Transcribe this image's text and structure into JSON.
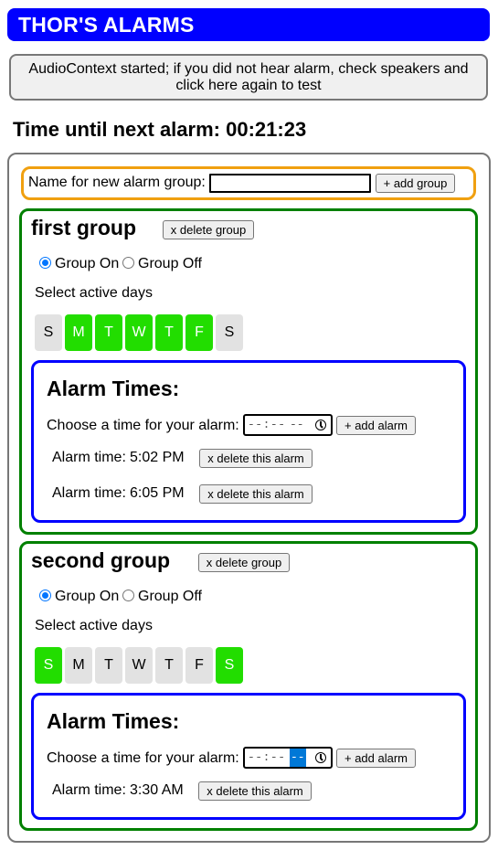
{
  "app": {
    "title": "THOR'S ALARMS"
  },
  "audio_button": {
    "text": "AudioContext started; if you did not hear alarm, check speakers and click here again to test"
  },
  "countdown": {
    "label": "Time until next alarm:",
    "value": "00:21:23"
  },
  "new_group": {
    "label": "Name for new alarm group:",
    "input_value": "",
    "add_label": "+ add group"
  },
  "common": {
    "delete_group_label": "x delete group",
    "group_on_label": "Group On",
    "group_off_label": "Group Off",
    "active_days_label": "Select active days",
    "alarm_times_title": "Alarm Times:",
    "choose_time_label": "Choose a time for your alarm:",
    "time_placeholder_hm": "--:--",
    "time_placeholder_ampm": "--",
    "add_alarm_label": "+ add alarm",
    "delete_alarm_label": "x delete this alarm",
    "alarm_time_prefix": "Alarm time:"
  },
  "groups": [
    {
      "name": "first group",
      "group_on": true,
      "days": [
        {
          "letter": "S",
          "active": false
        },
        {
          "letter": "M",
          "active": true
        },
        {
          "letter": "T",
          "active": true
        },
        {
          "letter": "W",
          "active": true
        },
        {
          "letter": "T",
          "active": true
        },
        {
          "letter": "F",
          "active": true
        },
        {
          "letter": "S",
          "active": false
        }
      ],
      "alarms": [
        {
          "time": "5:02 PM"
        },
        {
          "time": "6:05 PM"
        }
      ]
    },
    {
      "name": "second group",
      "group_on": true,
      "days": [
        {
          "letter": "S",
          "active": true
        },
        {
          "letter": "M",
          "active": false
        },
        {
          "letter": "T",
          "active": false
        },
        {
          "letter": "W",
          "active": false
        },
        {
          "letter": "T",
          "active": false
        },
        {
          "letter": "F",
          "active": false
        },
        {
          "letter": "S",
          "active": true
        }
      ],
      "alarms": [
        {
          "time": "3:30 AM"
        }
      ]
    }
  ],
  "colors": {
    "title_bar": "#0000ff",
    "new_group_border": "#f0a010",
    "group_border": "#008000",
    "alarm_box_border": "#0000ff",
    "day_active": "#22dd00",
    "day_inactive": "#e2e2e2",
    "radio_checked": "#0075ff"
  }
}
